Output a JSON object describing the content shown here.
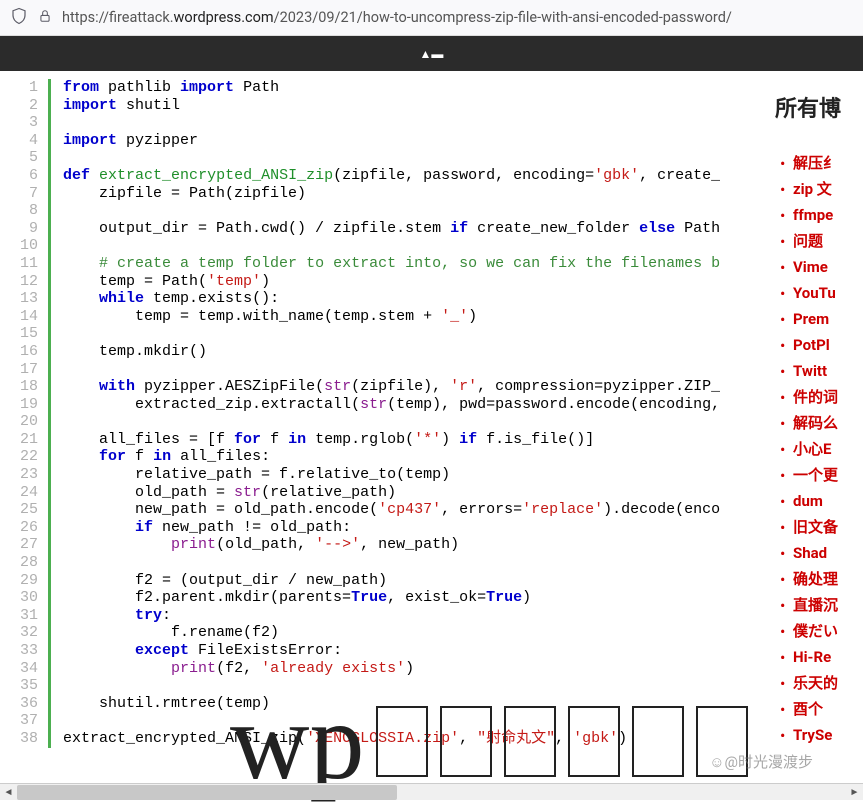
{
  "browser": {
    "url_prefix": "https://fireattack.",
    "url_bold": "wordpress.com",
    "url_suffix": "/2023/09/21/how-to-uncompress-zip-file-with-ansi-encoded-password/"
  },
  "sidebar": {
    "title": "所有博",
    "items": [
      "解压纟",
      "zip 文",
      "ffmpe",
      "问题",
      "Vime",
      "YouTu",
      "Prem",
      "PotPl",
      "Twitt",
      "件的词",
      "解码么",
      "小心E",
      "一个更",
      "dum",
      "旧文备",
      "Shad",
      "确处理",
      "直播沉",
      "僕だい",
      "Hi-Re",
      "乐天的",
      "酉个",
      "TrySe"
    ]
  },
  "code": {
    "line_count": 38,
    "tokens": [
      [
        [
          "kw",
          "from"
        ],
        [
          "",
          " pathlib "
        ],
        [
          "kw",
          "import"
        ],
        [
          "",
          " Path"
        ]
      ],
      [
        [
          "kw",
          "import"
        ],
        [
          "",
          " shutil"
        ]
      ],
      [
        [
          "",
          ""
        ]
      ],
      [
        [
          "kw",
          "import"
        ],
        [
          "",
          " pyzipper"
        ]
      ],
      [
        [
          "",
          ""
        ]
      ],
      [
        [
          "kw",
          "def"
        ],
        [
          "",
          " "
        ],
        [
          "fn",
          "extract_encrypted_ANSI_zip"
        ],
        [
          "",
          "(zipfile, password, encoding="
        ],
        [
          "str",
          "'gbk'"
        ],
        [
          "",
          ", create_"
        ]
      ],
      [
        [
          "",
          "    zipfile = Path(zipfile)"
        ]
      ],
      [
        [
          "",
          ""
        ]
      ],
      [
        [
          "",
          "    output_dir = Path.cwd() / zipfile.stem "
        ],
        [
          "kw",
          "if"
        ],
        [
          "",
          " create_new_folder "
        ],
        [
          "kw",
          "else"
        ],
        [
          "",
          " Path"
        ]
      ],
      [
        [
          "",
          ""
        ]
      ],
      [
        [
          "",
          "    "
        ],
        [
          "cmt",
          "# create a temp folder to extract into, so we can fix the filenames b"
        ]
      ],
      [
        [
          "",
          "    temp = Path("
        ],
        [
          "str",
          "'temp'"
        ],
        [
          "",
          ")"
        ]
      ],
      [
        [
          "",
          "    "
        ],
        [
          "kw",
          "while"
        ],
        [
          "",
          " temp.exists():"
        ]
      ],
      [
        [
          "",
          "        temp = temp.with_name(temp.stem + "
        ],
        [
          "str",
          "'_'"
        ],
        [
          "",
          ")"
        ]
      ],
      [
        [
          "",
          ""
        ]
      ],
      [
        [
          "",
          "    temp.mkdir()"
        ]
      ],
      [
        [
          "",
          ""
        ]
      ],
      [
        [
          "",
          "    "
        ],
        [
          "kw",
          "with"
        ],
        [
          "",
          " pyzipper.AESZipFile("
        ],
        [
          "bi",
          "str"
        ],
        [
          "",
          "(zipfile), "
        ],
        [
          "str",
          "'r'"
        ],
        [
          "",
          ", compression=pyzipper.ZIP_"
        ]
      ],
      [
        [
          "",
          "        extracted_zip.extractall("
        ],
        [
          "bi",
          "str"
        ],
        [
          "",
          "(temp), pwd=password.encode(encoding,"
        ]
      ],
      [
        [
          "",
          ""
        ]
      ],
      [
        [
          "",
          "    all_files = [f "
        ],
        [
          "kw",
          "for"
        ],
        [
          "",
          " f "
        ],
        [
          "kw",
          "in"
        ],
        [
          "",
          " temp.rglob("
        ],
        [
          "str",
          "'*'"
        ],
        [
          "",
          ") "
        ],
        [
          "kw",
          "if"
        ],
        [
          "",
          " f.is_file()]"
        ]
      ],
      [
        [
          "",
          "    "
        ],
        [
          "kw",
          "for"
        ],
        [
          "",
          " f "
        ],
        [
          "kw",
          "in"
        ],
        [
          "",
          " all_files:"
        ]
      ],
      [
        [
          "",
          "        relative_path = f.relative_to(temp)"
        ]
      ],
      [
        [
          "",
          "        old_path = "
        ],
        [
          "bi",
          "str"
        ],
        [
          "",
          "(relative_path)"
        ]
      ],
      [
        [
          "",
          "        new_path = old_path.encode("
        ],
        [
          "str",
          "'cp437'"
        ],
        [
          "",
          ", errors="
        ],
        [
          "str",
          "'replace'"
        ],
        [
          "",
          ").decode(enco"
        ]
      ],
      [
        [
          "",
          "        "
        ],
        [
          "kw",
          "if"
        ],
        [
          "",
          " new_path != old_path:"
        ]
      ],
      [
        [
          "",
          "            "
        ],
        [
          "bi",
          "print"
        ],
        [
          "",
          "(old_path, "
        ],
        [
          "str",
          "'-->'"
        ],
        [
          "",
          ", new_path)"
        ]
      ],
      [
        [
          "",
          ""
        ]
      ],
      [
        [
          "",
          "        f2 = (output_dir / new_path)"
        ]
      ],
      [
        [
          "",
          "        f2.parent.mkdir(parents="
        ],
        [
          "kw",
          "True"
        ],
        [
          "",
          ", exist_ok="
        ],
        [
          "kw",
          "True"
        ],
        [
          "",
          ")"
        ]
      ],
      [
        [
          "",
          "        "
        ],
        [
          "kw",
          "try"
        ],
        [
          "",
          ":"
        ]
      ],
      [
        [
          "",
          "            f.rename(f2)"
        ]
      ],
      [
        [
          "",
          "        "
        ],
        [
          "kw",
          "except"
        ],
        [
          "",
          " FileExistsError:"
        ]
      ],
      [
        [
          "",
          "            "
        ],
        [
          "bi",
          "print"
        ],
        [
          "",
          "(f2, "
        ],
        [
          "str",
          "'already exists'"
        ],
        [
          "",
          ")"
        ]
      ],
      [
        [
          "",
          ""
        ]
      ],
      [
        [
          "",
          "    shutil.rmtree(temp)"
        ]
      ],
      [
        [
          "",
          ""
        ]
      ],
      [
        [
          "",
          "extract_encrypted_ANSI_zip("
        ],
        [
          "str",
          "'XENOGLOSSIA.zip'"
        ],
        [
          "",
          ", "
        ],
        [
          "str",
          "\"射命丸文\""
        ],
        [
          "",
          ", "
        ],
        [
          "str",
          "'gbk'"
        ],
        [
          "",
          ")"
        ]
      ]
    ]
  },
  "overlay": {
    "wp_text": "wp",
    "box_count": 6,
    "watermark": "☺@时光漫渡步"
  }
}
